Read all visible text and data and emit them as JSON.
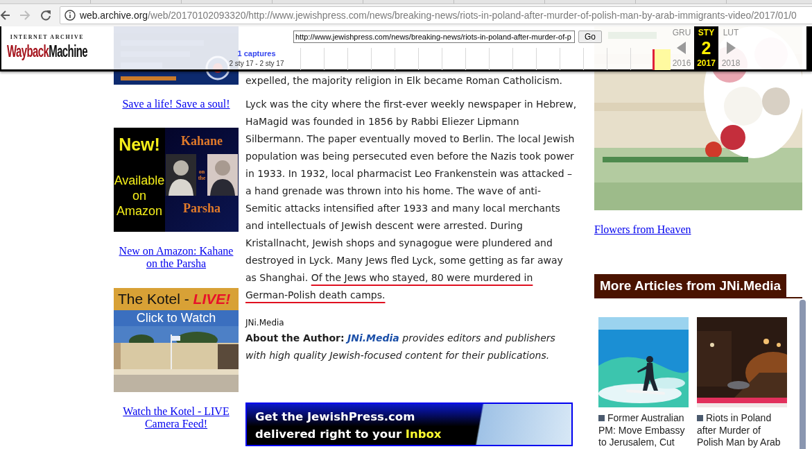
{
  "browser": {
    "back": {
      "disabled": false
    },
    "forward": {
      "disabled": true
    },
    "url_host": "web.archive.org",
    "url_rest": "/web/20170102093320/http://www.jewishpress.com/news/breaking-news/riots-in-poland-after-murder-of-polish-man-by-arab-immigrants-video/2017/01/0"
  },
  "wayback": {
    "logo_top": "INTERNET ARCHIVE",
    "logo_a": "Wayback",
    "logo_b": "Machine",
    "url_value": "http://www.jewishpress.com/news/breaking-news/riots-in-poland-after-murder-of-p",
    "go": "Go",
    "captures": "1 captures",
    "range": "2 sty 17 - 2 sty 17",
    "months": [
      {
        "label": "GRU",
        "year": "2016",
        "selected": false
      },
      {
        "label": "STY",
        "day": "2",
        "year": "2017",
        "selected": true
      },
      {
        "label": "LUT",
        "year": "2018",
        "selected": false
      }
    ]
  },
  "left_rail": {
    "ads": [
      {
        "kind": "crisis",
        "link": "Save a life! Save a soul!"
      },
      {
        "kind": "book",
        "badge": "New!",
        "availability": "Available on Amazon",
        "title": "Kahane",
        "connector": "on the",
        "subtitle": "Parsha",
        "link": "New on Amazon: Kahane on the Parsha"
      },
      {
        "kind": "live",
        "title": "The Kotel - ",
        "live": "LIVE!",
        "cta": "Click to Watch",
        "link": "Watch the Kotel - LIVE Camera Feed!"
      }
    ]
  },
  "article": {
    "lead": "expelled, the majority religion in Elk became Roman Catholicism.",
    "paragraph": "Lyck was the city where the first-ever weekly newspaper in Hebrew, HaMagid was founded in 1856 by Rabbi Eliezer Lipmann Silbermann. The paper eventually moved to Berlin. The local Jewish population was being persecuted even before the Nazis took power in 1933. In 1932, local pharmacist Leo Frankenstein was attacked – a hand grenade was thrown into his home. The wave of anti-Semitic attacks intensified after 1933 and many local merchants and intellectuals of Jewish descent were arrested. During Kristallnacht, Jewish shops and synagogue were plundered and destroyed in Lyck. Many Jews fled Lyck, some getting as far away as Shanghai.",
    "underlined": "Of the Jews who stayed, 80 were murdered in German-Polish death camps.",
    "byline": "JNi.Media",
    "about": {
      "label": "About the Author:",
      "link": "JNi.Media",
      "text": "provides editors and publishers with high quality Jewish-focused content for their publications."
    },
    "newsletter": {
      "line1": "Get the JewishPress.com",
      "line2": "delivered right to your",
      "highlight": "Inbox"
    }
  },
  "right_rail": {
    "ad_link": "Flowers from Heaven",
    "more_title": "More Articles from JNi.Media",
    "cards": [
      {
        "kind": "surf",
        "title": "Former Australian PM: Move Embassy to Jerusalem, Cut"
      },
      {
        "kind": "street",
        "title": "Riots in Poland after Murder of Polish Man by Arab"
      }
    ]
  }
}
